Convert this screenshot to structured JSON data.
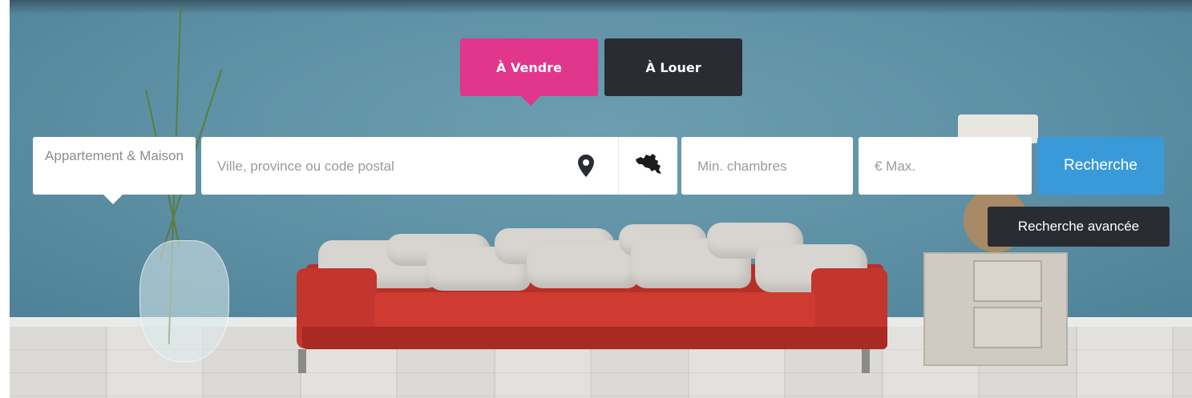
{
  "tabs": {
    "sale_label": "À Vendre",
    "rent_label": "À Louer",
    "active": "sale"
  },
  "search": {
    "property_type": "Appartement & Maison",
    "location_placeholder": "Ville, province ou code postal",
    "rooms_placeholder": "Min. chambres",
    "price_placeholder": "€ Max.",
    "search_label": "Recherche",
    "advanced_label": "Recherche avancée"
  },
  "icons": {
    "location": "map-pin-icon",
    "map": "belgium-map-icon"
  },
  "colors": {
    "sale_tab": "#e0368b",
    "rent_tab": "#2a2c33",
    "search_button": "#3a9ad9",
    "advanced_button": "#2a2c33"
  }
}
